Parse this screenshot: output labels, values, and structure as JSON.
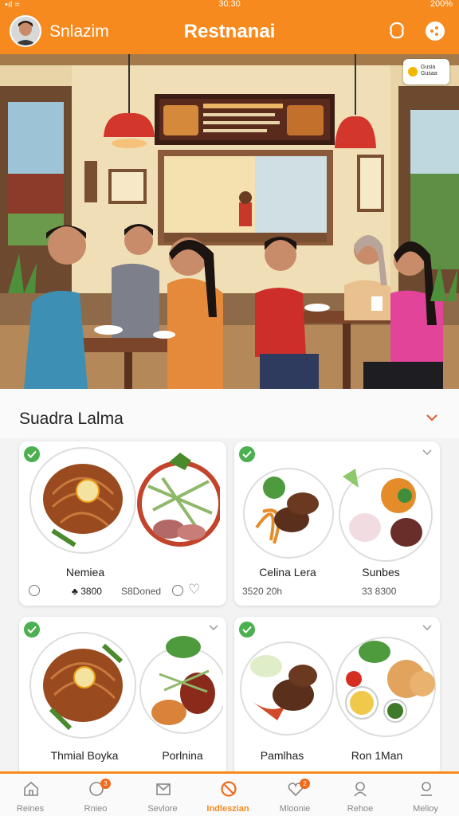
{
  "status": {
    "time": "30:30",
    "battery": "200%"
  },
  "header": {
    "user_name": "Snlazim",
    "title": "Restnanai"
  },
  "hero": {
    "badge_text": "Gusia Gusaa"
  },
  "section": {
    "title": "Suadra Lalma"
  },
  "cards": [
    {
      "name": "Nemiea",
      "price": "3800",
      "price_extra": "S8Doned"
    },
    {
      "name": "Celina Lera",
      "price": "3520 20h"
    },
    {
      "name": "Sunbes",
      "price": "33 8300"
    },
    {
      "name": "Thmial Boyka"
    },
    {
      "name": "Porlnina"
    },
    {
      "name": "Pamlhas"
    },
    {
      "name": "Ron 1Man"
    }
  ],
  "tabs": [
    {
      "label": "Reines",
      "icon": "home-icon"
    },
    {
      "label": "Rnieo",
      "icon": "chat-icon",
      "badge": "3"
    },
    {
      "label": "Sevlore",
      "icon": "mail-icon"
    },
    {
      "label": "Indleszian",
      "icon": "no-icon"
    },
    {
      "label": "Mloonie",
      "icon": "heart-icon",
      "badge": "2"
    },
    {
      "label": "Rehoe",
      "icon": "user-icon"
    },
    {
      "label": "Melioy",
      "icon": "profile-icon"
    }
  ],
  "colors": {
    "accent": "#f78a1f",
    "check": "#4caf50"
  }
}
